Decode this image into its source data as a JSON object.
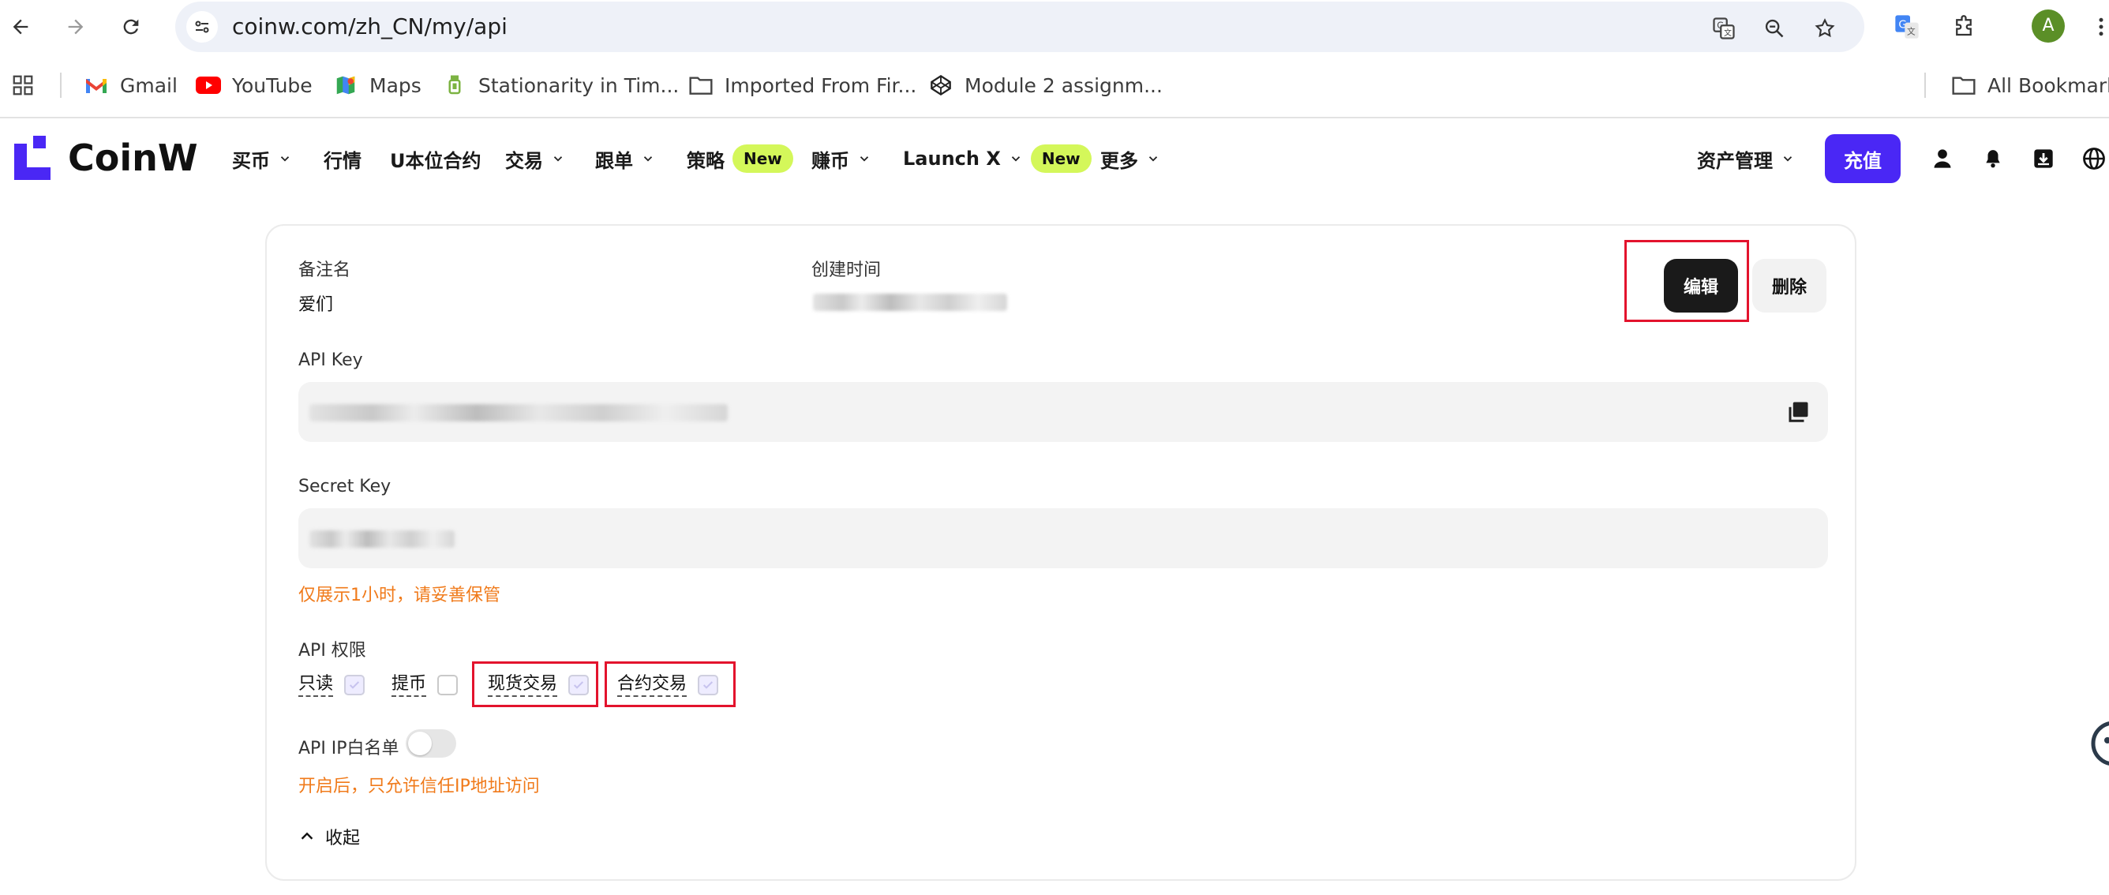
{
  "browser": {
    "url": "coinw.com/zh_CN/my/api",
    "avatar_letter": "A",
    "bookmarks": [
      {
        "label": "Gmail",
        "icon": "gmail-icon"
      },
      {
        "label": "YouTube",
        "icon": "youtube-icon"
      },
      {
        "label": "Maps",
        "icon": "maps-icon"
      },
      {
        "label": "Stationarity in Tim...",
        "icon": "bookmark-icon"
      },
      {
        "label": "Imported From Fir...",
        "icon": "folder-icon"
      },
      {
        "label": "Module 2 assignm...",
        "icon": "codepen-icon"
      }
    ],
    "all_bookmarks": "All Bookmarks"
  },
  "site": {
    "logo": "CoinW",
    "nav": [
      {
        "label": "买币",
        "dropdown": true
      },
      {
        "label": "行情",
        "dropdown": false
      },
      {
        "label": "U本位合约",
        "dropdown": false
      },
      {
        "label": "交易",
        "dropdown": true
      },
      {
        "label": "跟单",
        "dropdown": true
      },
      {
        "label": "策略",
        "badge": "New"
      },
      {
        "label": "赚币",
        "dropdown": true
      },
      {
        "label": "Launch X",
        "dropdown": true,
        "badge": "New"
      },
      {
        "label": "更多",
        "dropdown": true
      }
    ],
    "asset_menu": "资产管理",
    "deposit": "充值"
  },
  "api_card": {
    "remark_label": "备注名",
    "remark_value": "爱们",
    "created_label": "创建时间",
    "edit": "编辑",
    "delete": "删除",
    "api_key_label": "API Key",
    "secret_key_label": "Secret Key",
    "secret_warning": "仅展示1小时，请妥善保管",
    "permissions_label": "API 权限",
    "permissions": [
      {
        "label": "只读",
        "checked": true
      },
      {
        "label": "提币",
        "checked": false
      },
      {
        "label": "现货交易",
        "checked": true
      },
      {
        "label": "合约交易",
        "checked": true
      }
    ],
    "whitelist_label": "API IP白名单",
    "whitelist_enabled": false,
    "whitelist_warning": "开启后，只允许信任IP地址访问",
    "collapse": "收起"
  },
  "colors": {
    "brand_purple": "#4a27f5",
    "badge_green": "#d4f75a",
    "warning_orange": "#f07a1a",
    "highlight_red": "#e3132d"
  }
}
